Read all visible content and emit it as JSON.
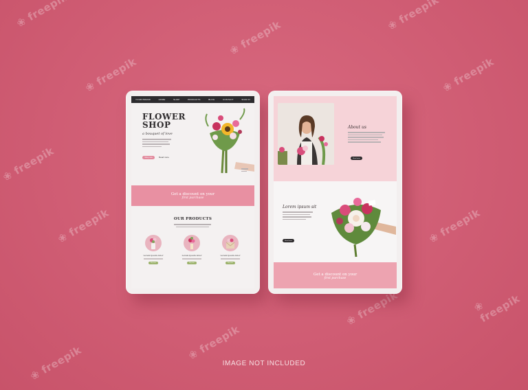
{
  "watermark": "freepik",
  "footer": {
    "text": "IMAGE NOT INCLUDED"
  },
  "left_tablet": {
    "nav": {
      "items": [
        "YOUR BRAND",
        "HOME",
        "SHOP",
        "PRODUCTS",
        "BLOG",
        "CONTACT",
        "SIGN IN"
      ]
    },
    "hero": {
      "title_line1": "FLOWER",
      "title_line2": "SHOP",
      "script": "a bouquet of love",
      "primary_button": "Shop now",
      "secondary_link": "Read more"
    },
    "banner": {
      "line1": "Get a discount on your",
      "line2": "first purchase"
    },
    "products": {
      "heading": "OUR PRODUCTS",
      "items": [
        {
          "name": "Lorem Ipsum dolor",
          "button": "Buy now"
        },
        {
          "name": "Lorem Ipsum dolor",
          "button": "Buy now"
        },
        {
          "name": "Lorem Ipsum dolor",
          "button": "Buy now"
        }
      ]
    }
  },
  "right_tablet": {
    "about": {
      "heading": "About us",
      "button": "Read more"
    },
    "section2": {
      "heading": "Lorem ipsum sit",
      "button": "Read more"
    },
    "banner": {
      "line1": "Get a discount on your",
      "line2": "first purchase"
    }
  },
  "colors": {
    "background": "#cf5c73",
    "pink": "#e890a2",
    "dark": "#2c2b2e",
    "green": "#9bb26b"
  }
}
